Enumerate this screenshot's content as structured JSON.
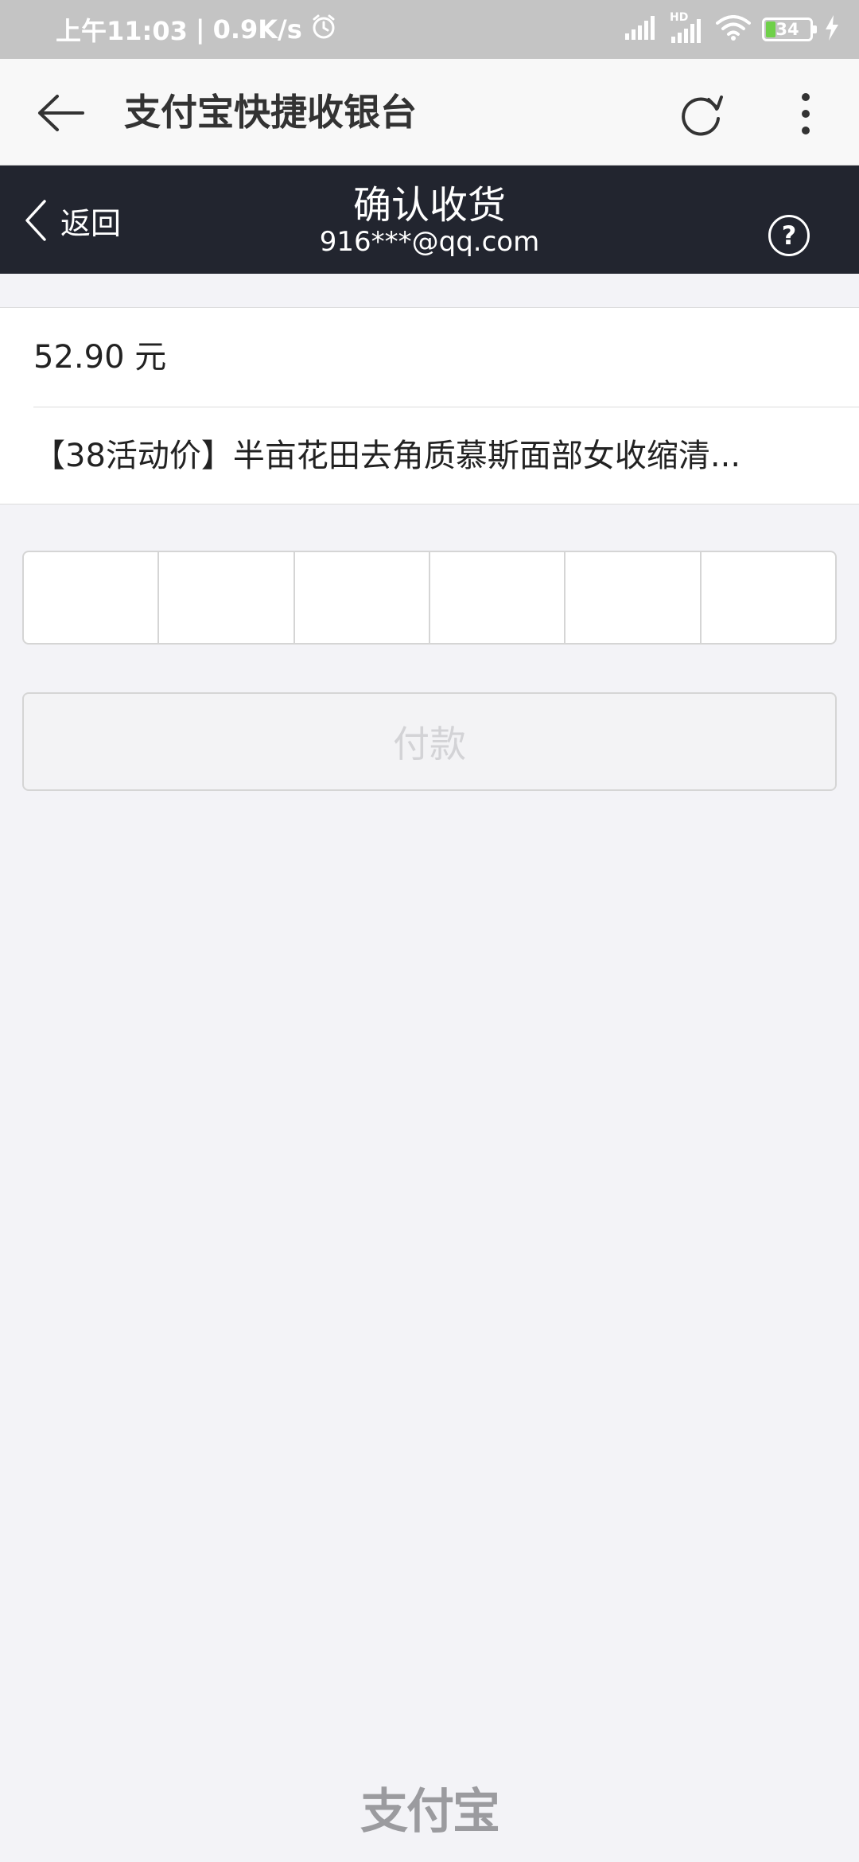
{
  "status_bar": {
    "time": "上午11:03",
    "net_speed": "0.9K/s",
    "battery": "34",
    "hd_label": "HD"
  },
  "app_bar": {
    "title": "支付宝快捷收银台"
  },
  "page_header": {
    "back_label": "返回",
    "title": "确认收货",
    "account": "916***@qq.com",
    "help": "?"
  },
  "order": {
    "amount": "52.90 元",
    "item_title": "【38活动价】半亩花田去角质慕斯面部女收缩清..."
  },
  "pay_button": {
    "label": "付款"
  },
  "footer": {
    "logo_text": "支付宝"
  },
  "colors": {
    "header_bg": "#22252f",
    "page_bg": "#f3f3f7",
    "status_bg": "#c4c4c4",
    "battery_green": "#6fd049"
  }
}
